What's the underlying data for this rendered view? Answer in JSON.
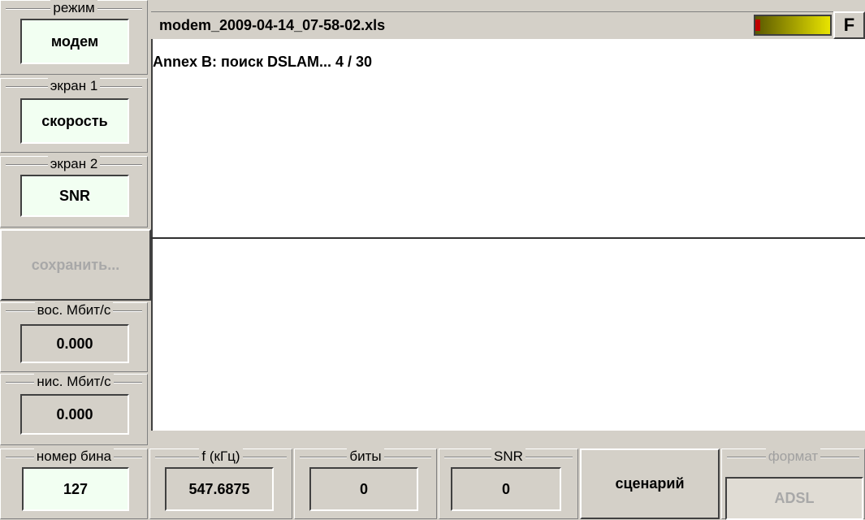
{
  "left_panel": {
    "mode": {
      "title": "режим",
      "value": "модем"
    },
    "screen1": {
      "title": "экран 1",
      "value": "скорость"
    },
    "screen2": {
      "title": "экран 2",
      "value": "SNR"
    },
    "save_label": "сохранить...",
    "upstream": {
      "title": "вос. Мбит/с",
      "value": "0.000"
    },
    "downstream": {
      "title": "нис. Мбит/с",
      "value": "0.000"
    }
  },
  "header": {
    "filename": "modem_2009-04-14_07-58-02.xls",
    "f_button": "F"
  },
  "content": {
    "status": "Annex B: поиск DSLAM... 4 / 30"
  },
  "bottom_bar": {
    "bin": {
      "title": "номер бина",
      "value": "127"
    },
    "freq": {
      "title": "f (кГц)",
      "value": "547.6875"
    },
    "bits": {
      "title": "биты",
      "value": "0"
    },
    "snr": {
      "title": "SNR",
      "value": "0"
    },
    "scenario_label": "сценарий",
    "format": {
      "title": "формат",
      "value": "ADSL"
    }
  },
  "colors": {
    "panel": "#d4d0c8",
    "value_box_light": "#f2fff2",
    "indicator_red": "#c00000",
    "indicator_yellow": "#e8e400"
  }
}
